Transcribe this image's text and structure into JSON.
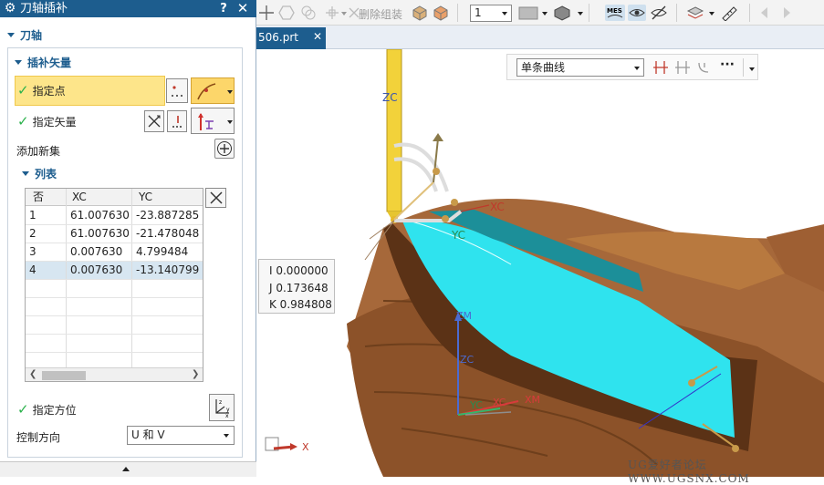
{
  "dialog": {
    "title": "刀轴插补",
    "help_label": "?",
    "close_label": "✕",
    "section_tool_axis": "刀轴",
    "section_interpolate_vector": "插补矢量",
    "specify_point_label": "指定点",
    "specify_vector_label": "指定矢量",
    "add_new_set_label": "添加新集",
    "list_section": "列表",
    "specify_orientation_label": "指定方位",
    "control_direction_label": "控制方向",
    "control_direction_value": "U 和 V",
    "table": {
      "columns": [
        "否",
        "XC",
        "YC"
      ],
      "rows": [
        [
          "1",
          "61.007630",
          "-23.887285"
        ],
        [
          "2",
          "61.007630",
          "-21.478048"
        ],
        [
          "3",
          "0.007630",
          "4.799484"
        ],
        [
          "4",
          "0.007630",
          "-13.140799"
        ]
      ],
      "selected_row": 4
    }
  },
  "toolbar": {
    "delete_group_label": "删除组装",
    "layer_value": "1"
  },
  "tab": {
    "name": "506.prt",
    "close_label": "✕"
  },
  "viewport": {
    "curve_filter_value": "单条曲线",
    "ijk": {
      "i": "I  0.000000",
      "j": "J  0.173648",
      "k": "K  0.984808"
    },
    "labels": {
      "zc_top": "ZC",
      "xc_top": "XC",
      "yc_top": "YC",
      "zm": "ZM",
      "zc_mid": "ZC",
      "yc_mid": "YC",
      "xm": "XM",
      "xc_mid": "XC",
      "x_axis": "X"
    },
    "watermark": "UG爱好者论坛 WWW.UGSNX.COM"
  },
  "colors": {
    "title_bar": "#1d5d8e",
    "highlight_row": "#fde58a",
    "check_green": "#2bb24c",
    "selected_row": "#d7e6f1",
    "part_bronze": "#a6683a",
    "surface_cyan": "#2fe3ee",
    "tool_yellow": "#f2d23a"
  }
}
